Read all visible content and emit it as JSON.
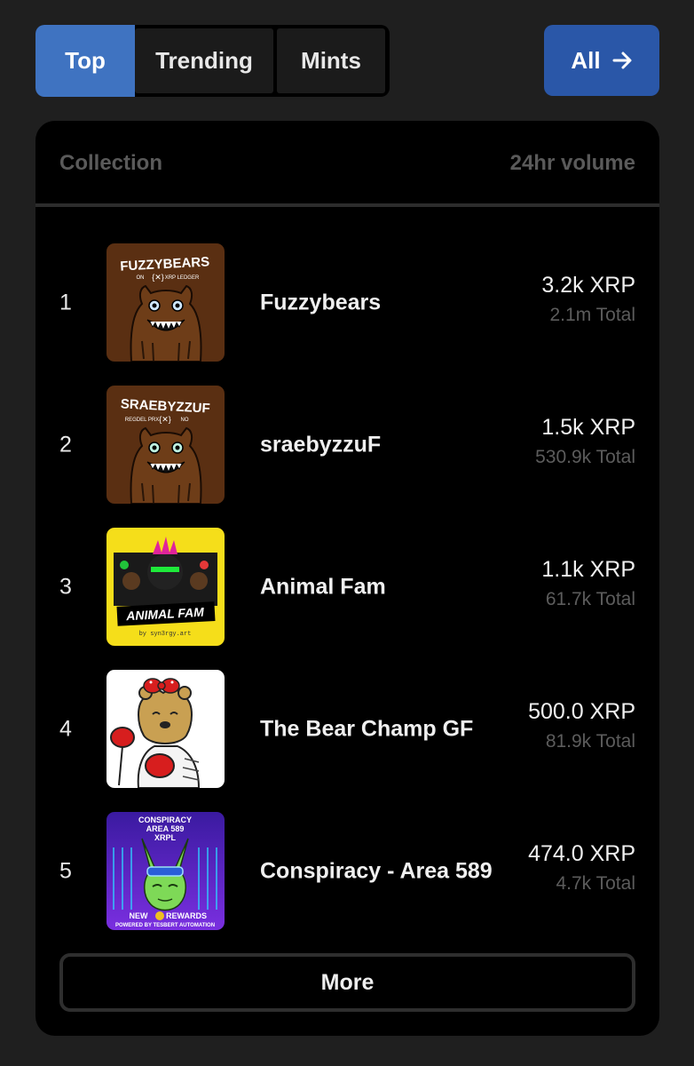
{
  "tabs": [
    {
      "label": "Top",
      "active": true
    },
    {
      "label": "Trending",
      "active": false
    },
    {
      "label": "Mints",
      "active": false
    }
  ],
  "all_button": {
    "label": "All",
    "icon": "arrow-right-icon"
  },
  "table": {
    "col_collection": "Collection",
    "col_volume": "24hr volume",
    "rows": [
      {
        "rank": "1",
        "name": "Fuzzybears",
        "volume": "3.2k XRP",
        "total": "2.1m Total",
        "thumb_title": "FUZZYBEARS",
        "thumb_sub_left": "ON",
        "thumb_sub_mark": "{✕}",
        "thumb_sub_right": "XRP LEDGER"
      },
      {
        "rank": "2",
        "name": "sraebyzzuF",
        "volume": "1.5k XRP",
        "total": "530.9k Total",
        "thumb_title": "SRAEBYZZUF",
        "thumb_sub_left": "REGDEL PRX",
        "thumb_sub_mark": "{✕}",
        "thumb_sub_right": "NO"
      },
      {
        "rank": "3",
        "name": "Animal Fam",
        "volume": "1.1k XRP",
        "total": "61.7k Total",
        "thumb_title": "ANIMAL FAM",
        "thumb_sub": "by syn3rgy.art"
      },
      {
        "rank": "4",
        "name": "The Bear Champ GF",
        "volume": "500.0 XRP",
        "total": "81.9k Total"
      },
      {
        "rank": "5",
        "name": "Conspiracy - Area 589",
        "volume": "474.0 XRP",
        "total": "4.7k Total",
        "thumb_title_1": "CONSPIRACY",
        "thumb_title_2": "AREA 589",
        "thumb_title_3": "XRPL",
        "thumb_footer_left": "NEW",
        "thumb_footer_right": "REWARDS",
        "thumb_footer_sub": "POWERED BY TESBERT AUTOMATION"
      }
    ]
  },
  "more_button": {
    "label": "More"
  },
  "colors": {
    "page_bg": "#1f1f1f",
    "card_bg": "#000000",
    "active_tab": "#3f73c1",
    "all_button": "#2a57a8",
    "muted_text": "#5c5c5c"
  }
}
